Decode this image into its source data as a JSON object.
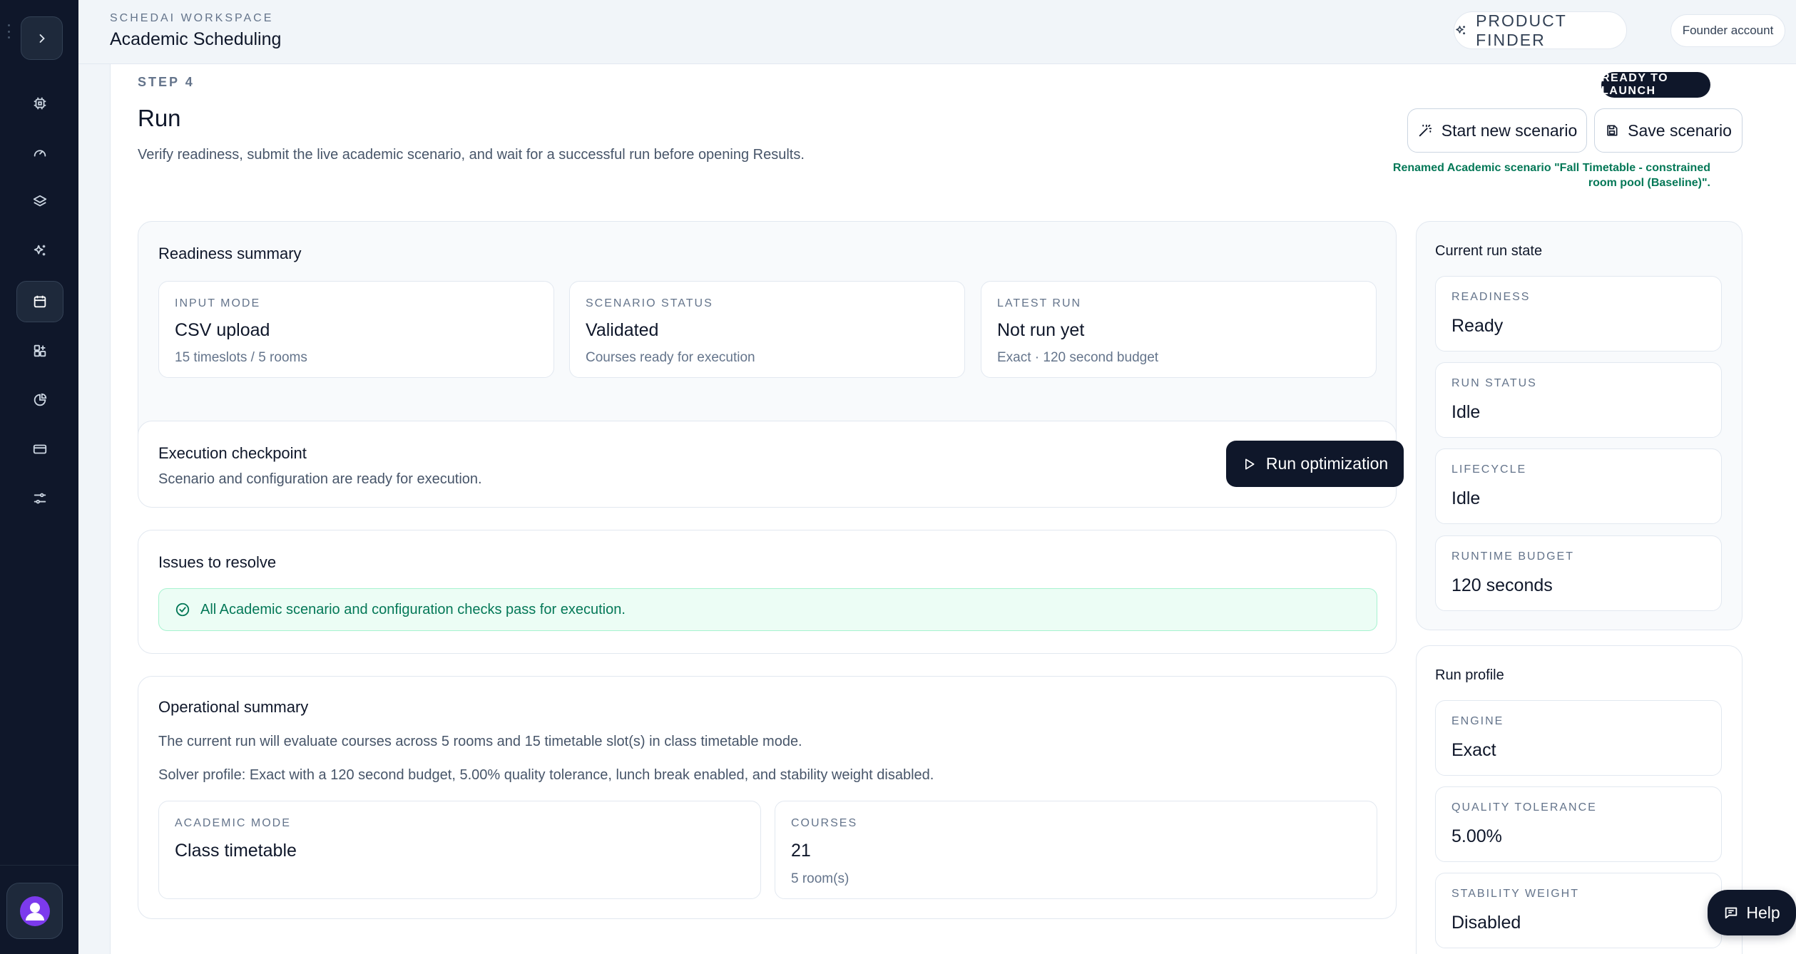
{
  "topbar": {
    "eyebrow": "SCHEDAI WORKSPACE",
    "title": "Academic Scheduling",
    "product_finder": "PRODUCT FINDER",
    "account": "Founder account"
  },
  "header": {
    "step": "STEP 4",
    "title": "Run",
    "description": "Verify readiness, submit the live academic scenario, and wait for a successful run before opening Results.",
    "badge": "READY TO LAUNCH",
    "start_new": "Start new scenario",
    "save": "Save scenario",
    "notice": "Renamed Academic scenario \"Fall Timetable - constrained room pool (Baseline)\"."
  },
  "readiness": {
    "title": "Readiness summary",
    "tiles": [
      {
        "label": "INPUT MODE",
        "value": "CSV upload",
        "sub": "15 timeslots / 5 rooms"
      },
      {
        "label": "SCENARIO STATUS",
        "value": "Validated",
        "sub": "Courses ready for execution"
      },
      {
        "label": "LATEST RUN",
        "value": "Not run yet",
        "sub": "Exact · 120 second budget"
      }
    ]
  },
  "checkpoint": {
    "title": "Execution checkpoint",
    "text": "Scenario and configuration are ready for execution.",
    "button": "Run optimization"
  },
  "issues": {
    "title": "Issues to resolve",
    "message": "All Academic scenario and configuration checks pass for execution."
  },
  "operational": {
    "title": "Operational summary",
    "line1": "The current run will evaluate courses across 5 rooms and 15 timetable slot(s) in class timetable mode.",
    "line2": "Solver profile: Exact with a 120 second budget, 5.00% quality tolerance, lunch break enabled, and stability weight disabled.",
    "tiles": [
      {
        "label": "ACADEMIC MODE",
        "value": "Class timetable",
        "sub": ""
      },
      {
        "label": "COURSES",
        "value": "21",
        "sub": "5 room(s)"
      }
    ]
  },
  "run_state": {
    "title": "Current run state",
    "items": [
      {
        "label": "READINESS",
        "value": "Ready"
      },
      {
        "label": "RUN STATUS",
        "value": "Idle"
      },
      {
        "label": "LIFECYCLE",
        "value": "Idle"
      },
      {
        "label": "RUNTIME BUDGET",
        "value": "120 seconds"
      }
    ]
  },
  "run_profile": {
    "title": "Run profile",
    "items": [
      {
        "label": "ENGINE",
        "value": "Exact"
      },
      {
        "label": "QUALITY TOLERANCE",
        "value": "5.00%"
      },
      {
        "label": "STABILITY WEIGHT",
        "value": "Disabled"
      }
    ]
  },
  "help": {
    "label": "Help"
  },
  "colors": {
    "sidebar": "#0f172a",
    "success": "#047857",
    "success_bg": "#ecfdf5",
    "primary": "#0f172a"
  }
}
